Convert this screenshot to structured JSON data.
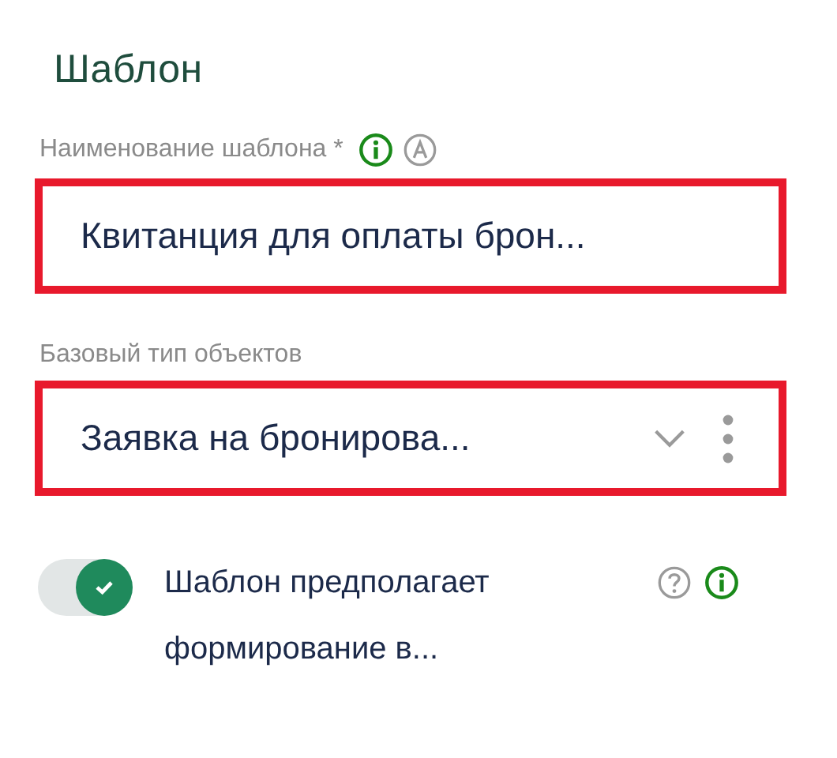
{
  "section_title": "Шаблон",
  "fields": [
    {
      "kind": "text",
      "label": "Наименование шаблона *",
      "info_icon": true,
      "auto_icon": true,
      "value": "Квитанция для оплаты брон..."
    },
    {
      "kind": "select",
      "label": "Базовый тип объектов",
      "value": "Заявка на бронирова..."
    }
  ],
  "toggle": {
    "on": true,
    "label": "Шаблон предполагает формирование в...",
    "help_icon": true,
    "info_icon": true
  }
}
